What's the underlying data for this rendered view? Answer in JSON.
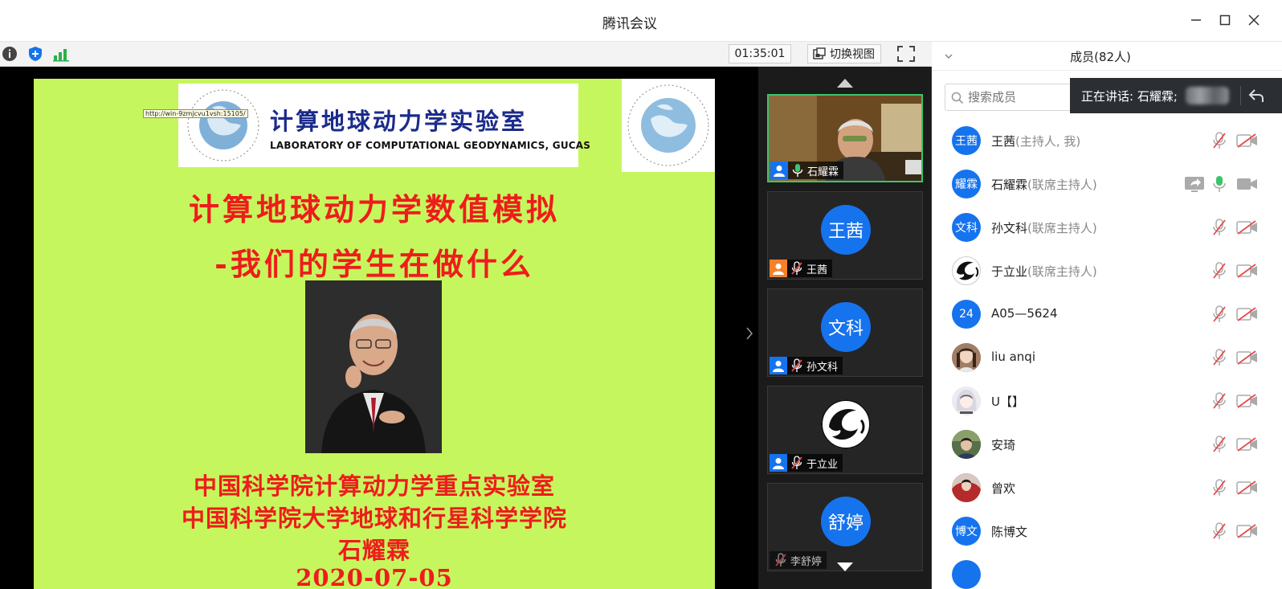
{
  "window": {
    "title": "腾讯会议",
    "minimize_icon": "minimize-icon",
    "maximize_icon": "maximize-icon",
    "close_icon": "close-icon"
  },
  "toolbar": {
    "timer": "01:35:01",
    "switch_view_label": "切换视图",
    "icons": [
      "info-icon",
      "shield-icon",
      "signal-icon",
      "fullscreen-icon"
    ]
  },
  "slide": {
    "url_tooltip": "http://win-9zmjcvu1vsh:15105/",
    "logo_cn": "计算地球动力学实验室",
    "logo_en": "LABORATORY OF COMPUTATIONAL GEODYNAMICS, GUCAS",
    "title_line1": "计算地球动力学数值模拟",
    "title_line2": "-我们的学生在做什么",
    "institution1": "中国科学院计算动力学重点实验室",
    "institution2": "中国科学院大学地球和行星科学学院",
    "presenter": "石耀霖",
    "date": "2020-07-05"
  },
  "video_tiles": [
    {
      "name": "石耀霖",
      "avatar_text": "",
      "muted": false,
      "active": true,
      "role_icon": "user-icon"
    },
    {
      "name": "王茜",
      "avatar_text": "王茜",
      "muted": true,
      "active": false,
      "role_icon": "host-icon"
    },
    {
      "name": "孙文科",
      "avatar_text": "文科",
      "muted": true,
      "active": false,
      "role_icon": "user-icon"
    },
    {
      "name": "于立业",
      "avatar_text": "",
      "muted": true,
      "active": false,
      "role_icon": "user-icon"
    },
    {
      "name": "李舒婷",
      "avatar_text": "舒婷",
      "muted": true,
      "active": false,
      "role_icon": ""
    }
  ],
  "members_panel": {
    "title": "成员(82人)",
    "search_placeholder": "搜索成员",
    "speaking_label": "正在讲话: 石耀霖;",
    "members": [
      {
        "avatar": "王茜",
        "name": "王茜",
        "role": "(主持人, 我)",
        "mic": "muted",
        "cam": "off",
        "sharing": false
      },
      {
        "avatar": "耀霖",
        "name": "石耀霖",
        "role": "(联席主持人)",
        "mic": "on",
        "cam": "on",
        "sharing": true
      },
      {
        "avatar": "文科",
        "name": "孙文科",
        "role": "(联席主持人)",
        "mic": "muted",
        "cam": "off",
        "sharing": false
      },
      {
        "avatar": "",
        "name": "于立业",
        "role": "(联席主持人)",
        "mic": "muted",
        "cam": "off",
        "sharing": false
      },
      {
        "avatar": "24",
        "name": "A05—5624",
        "role": "",
        "mic": "muted",
        "cam": "off",
        "sharing": false
      },
      {
        "avatar": "",
        "name": "liu anqi",
        "role": "",
        "mic": "muted",
        "cam": "off",
        "sharing": false
      },
      {
        "avatar": "",
        "name": "U【】",
        "role": "",
        "mic": "muted",
        "cam": "off",
        "sharing": false
      },
      {
        "avatar": "",
        "name": "安琦",
        "role": "",
        "mic": "muted",
        "cam": "off",
        "sharing": false
      },
      {
        "avatar": "",
        "name": "曾欢",
        "role": "",
        "mic": "muted",
        "cam": "off",
        "sharing": false
      },
      {
        "avatar": "博文",
        "name": "陈博文",
        "role": "",
        "mic": "muted",
        "cam": "off",
        "sharing": false
      }
    ]
  },
  "colors": {
    "accent_blue": "#1673ee",
    "slide_bg": "#c6f65d",
    "slide_text_red": "#ee1c1c",
    "active_green": "#3cc46d",
    "mic_on_green": "#3cc46d",
    "muted_red": "#e64a4a"
  }
}
